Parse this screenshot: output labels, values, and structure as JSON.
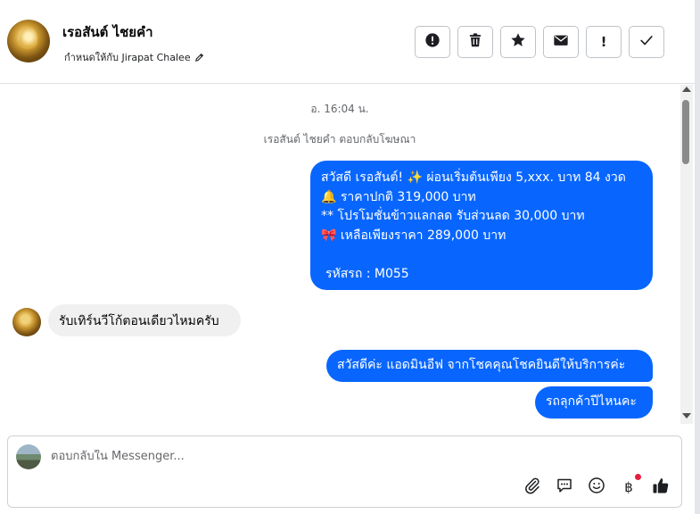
{
  "header": {
    "contact_name": "เรอสันต์ ไชยคำ",
    "assigned_to": "กำหนดให้กับ Jirapat Chalee",
    "actions": [
      {
        "icon": "alert-circle-icon",
        "label": ""
      },
      {
        "icon": "trash-icon",
        "label": ""
      },
      {
        "icon": "star-icon",
        "label": ""
      },
      {
        "icon": "envelope-icon",
        "label": ""
      },
      {
        "icon": "exclamation-icon",
        "label": "!"
      },
      {
        "icon": "checkmark-icon",
        "label": ""
      }
    ]
  },
  "conversation": {
    "timestamp": "อ. 16:04 น.",
    "reply_note": "เรอสันต์ ไชยคำ ตอบกลับโฆษณา",
    "message_1": {
      "line1": "สวัสดี เรอสันต์! ✨  ผ่อนเริ่มต้นเพียง 5,xxx. บาท 84 งวด",
      "line2": "🔔 ราคาปกติ 319,000 บาท",
      "line3": "** โปรโมชั่นข้าวแลกลด รับส่วนลด 30,000 บาท",
      "line4": "🎀  เหลือเพียงราคา 289,000 บาท",
      "line5": "รหัสรถ : M055"
    },
    "message_2": "รับเทิร์นวีโก้ตอนเดียวไหมครับ",
    "message_3": "สวัสดีค่ะ แอดมินอีฟ จากโชคคุณโชคยินดีให้บริการค่ะ",
    "message_4": "รถลุกค้าปีไหนคะ"
  },
  "composer": {
    "placeholder": "ตอบกลับใน Messenger...",
    "value": "",
    "tools": [
      "paperclip-icon",
      "chat-bubble-icon",
      "smiley-icon",
      "baht-icon",
      "thumbs-up-icon"
    ],
    "baht_symbol": "฿"
  },
  "colors": {
    "accent": "#0866ff",
    "incoming_bubble": "#f0f0f0",
    "badge": "#e41e3f"
  }
}
